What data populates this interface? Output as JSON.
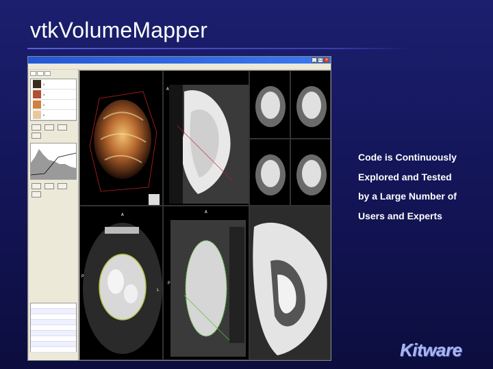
{
  "slide": {
    "title": "vtkVolumeMapper",
    "caption_lines": [
      "Code is Continuously",
      "Explored and Tested",
      "by a Large Number of",
      "Users and Experts"
    ],
    "logo_text": "Kitware"
  },
  "colors": {
    "background": "#14165a",
    "title_text": "#ffffff",
    "logo": "#aab6f0",
    "window_titlebar": "#2458d6"
  },
  "screenshot": {
    "window_controls": [
      "_",
      "□",
      "×"
    ],
    "viewport_labels": {
      "sagittal_a": "A",
      "axial_a": "A",
      "axial_p": "P",
      "axial_l": "L",
      "oblique_a": "A",
      "oblique_p": "P"
    },
    "swatch_colors": [
      "#3a2a1a",
      "#b05030",
      "#d08040",
      "#e8c8a0"
    ],
    "swatch_values": [
      "0",
      "0",
      "0",
      "0"
    ]
  }
}
